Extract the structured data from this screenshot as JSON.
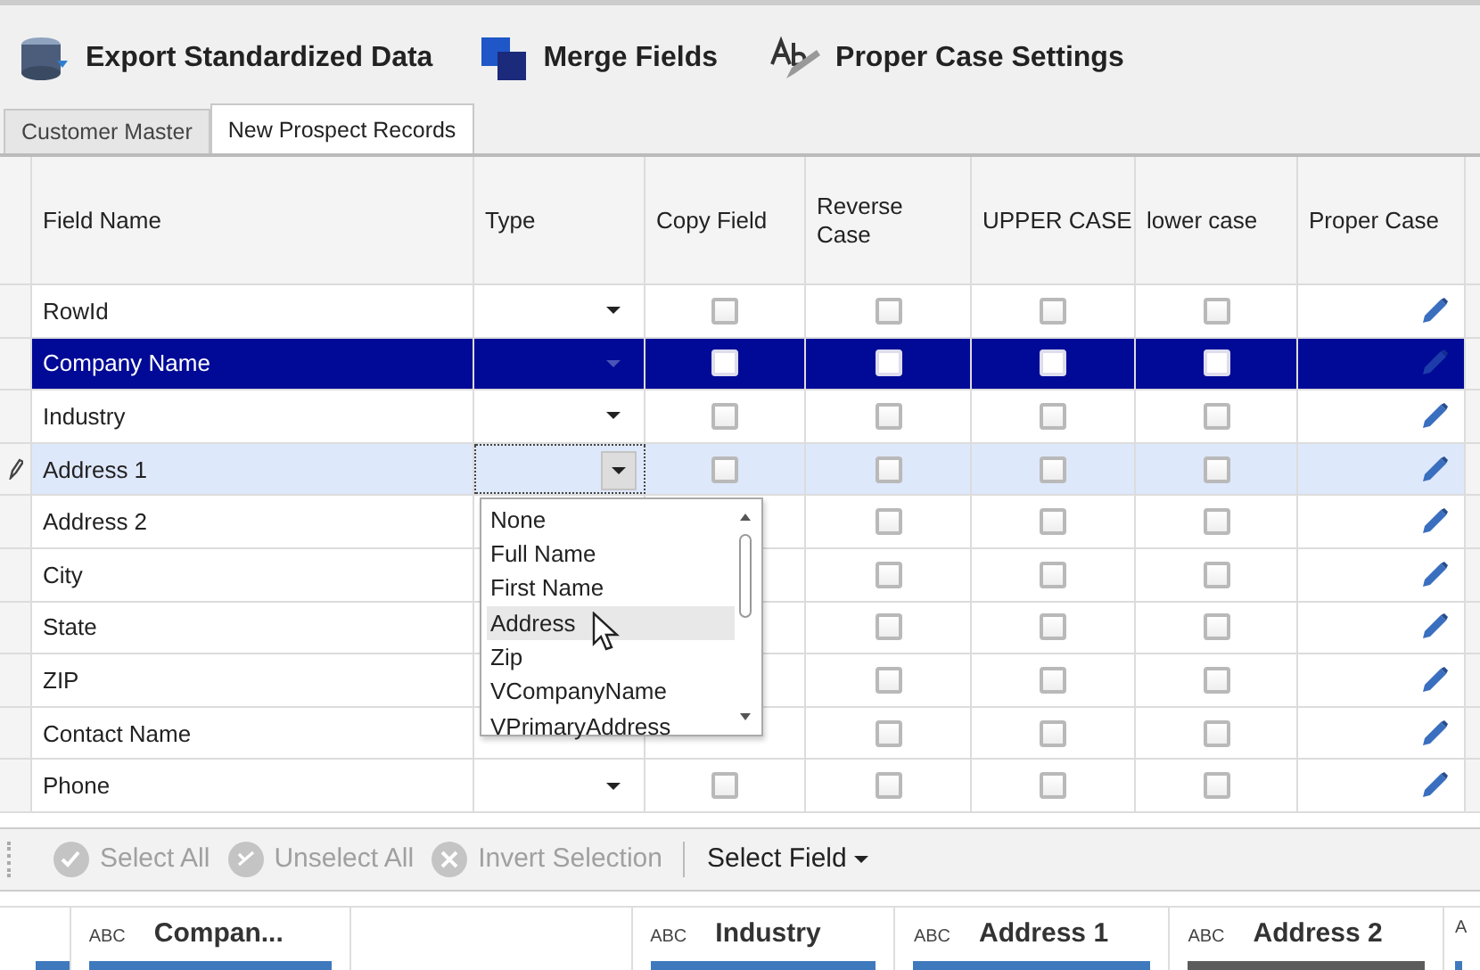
{
  "toolbar": [
    {
      "label": "Export Standardized Data"
    },
    {
      "label": "Merge Fields"
    },
    {
      "label": "Proper Case Settings"
    }
  ],
  "tabs": [
    {
      "label": "Customer Master",
      "selected": false
    },
    {
      "label": "New Prospect Records",
      "selected": true
    }
  ],
  "grid": {
    "columns": [
      "Field Name",
      "Type",
      "Copy Field",
      "Reverse Case",
      "UPPER CASE",
      "lower case",
      "Proper Case"
    ],
    "rows": [
      {
        "field_name": "RowId",
        "selected": false,
        "editing": false,
        "arrow": true,
        "copy_field": false,
        "reverse_case": false,
        "upper_case": false,
        "lower_case": false
      },
      {
        "field_name": "Company Name",
        "selected": true,
        "editing": false,
        "arrow": true,
        "copy_field": false,
        "reverse_case": false,
        "upper_case": false,
        "lower_case": false
      },
      {
        "field_name": "Industry",
        "selected": false,
        "editing": false,
        "arrow": true,
        "copy_field": false,
        "reverse_case": false,
        "upper_case": false,
        "lower_case": false
      },
      {
        "field_name": "Address 1",
        "selected": false,
        "editing": true,
        "arrow": true,
        "copy_field": false,
        "reverse_case": false,
        "upper_case": false,
        "lower_case": false,
        "dropdown": {
          "options": [
            {
              "label": "None",
              "selected": false
            },
            {
              "label": "Full Name",
              "selected": false
            },
            {
              "label": "First Name",
              "selected": false
            },
            {
              "label": "Address",
              "selected": true
            },
            {
              "label": "Zip",
              "selected": false
            },
            {
              "label": "VCompanyName",
              "selected": false
            },
            {
              "label": "VPrimaryAddress",
              "selected": false
            }
          ]
        }
      },
      {
        "field_name": "Address 2",
        "selected": false,
        "editing": false,
        "arrow": false,
        "reverse_case": false,
        "upper_case": false,
        "lower_case": false
      },
      {
        "field_name": "City",
        "selected": false,
        "editing": false,
        "arrow": false,
        "reverse_case": false,
        "upper_case": false,
        "lower_case": false
      },
      {
        "field_name": "State",
        "selected": false,
        "editing": false,
        "arrow": false,
        "reverse_case": false,
        "upper_case": false,
        "lower_case": false
      },
      {
        "field_name": "ZIP",
        "selected": false,
        "editing": false,
        "arrow": false,
        "reverse_case": false,
        "upper_case": false,
        "lower_case": false
      },
      {
        "field_name": "Contact Name",
        "selected": false,
        "editing": false,
        "arrow": false,
        "reverse_case": false,
        "upper_case": false,
        "lower_case": false
      },
      {
        "field_name": "Phone",
        "selected": false,
        "editing": false,
        "arrow": true,
        "copy_field": false,
        "reverse_case": false,
        "upper_case": false,
        "lower_case": false
      }
    ]
  },
  "selection_bar": {
    "buttons": [
      {
        "label": "Select All",
        "disabled": true
      },
      {
        "label": "Unselect All",
        "disabled": true
      },
      {
        "label": "Invert Selection",
        "disabled": true
      }
    ],
    "menu": {
      "label": "Select Field"
    }
  },
  "preview_columns": [
    {
      "type_label": "ABC",
      "name": "Compan...",
      "color": "#3f79bd"
    },
    {
      "type_label": "ABC",
      "name": "Industry",
      "color": "#3f79bd"
    },
    {
      "type_label": "ABC",
      "name": "Address 1",
      "color": "#3f79bd"
    },
    {
      "type_label": "ABC",
      "name": "Address 2",
      "color": "#5c5c5c"
    },
    {
      "type_label": "A",
      "color": "#3f79bd"
    }
  ]
}
